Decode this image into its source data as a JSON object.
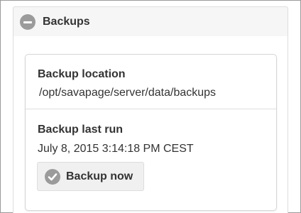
{
  "section": {
    "title": "Backups",
    "expanded": true,
    "header_icon": "minus-icon"
  },
  "backup_location": {
    "label": "Backup location",
    "value": "/opt/savapage/server/data/backups"
  },
  "backup_last_run": {
    "label": "Backup last run",
    "value": "July 8, 2015 3:14:18 PM CEST"
  },
  "backup_button": {
    "label": "Backup now",
    "icon": "check-icon"
  },
  "colors": {
    "header_bg": "#f6f6f6",
    "icon_gray": "#9b9b9b",
    "text": "#333333",
    "button_bg": "#f0f0f0"
  }
}
